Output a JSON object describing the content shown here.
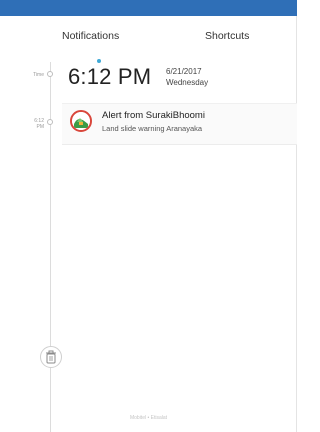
{
  "tabs": {
    "notifications": "Notifications",
    "shortcuts": "Shortcuts"
  },
  "timeline": {
    "time_label": "Time",
    "notif_time_label_1": "6:12",
    "notif_time_label_2": "PM"
  },
  "header": {
    "time": "6:12 PM",
    "date": "6/21/2017",
    "day": "Wednesday"
  },
  "notification": {
    "title": "Alert from SurakiBhoomi",
    "body": "Land slide warning  Aranayaka"
  },
  "footer": {
    "text": "Mobitel • Etisalat"
  },
  "colors": {
    "status_bar": "#2f6fb7",
    "tab_indicator": "#3fa9d6",
    "icon_border": "#d9463b"
  },
  "icons": {
    "app": "surakibhoomi-app-icon",
    "trash": "trash-icon"
  }
}
